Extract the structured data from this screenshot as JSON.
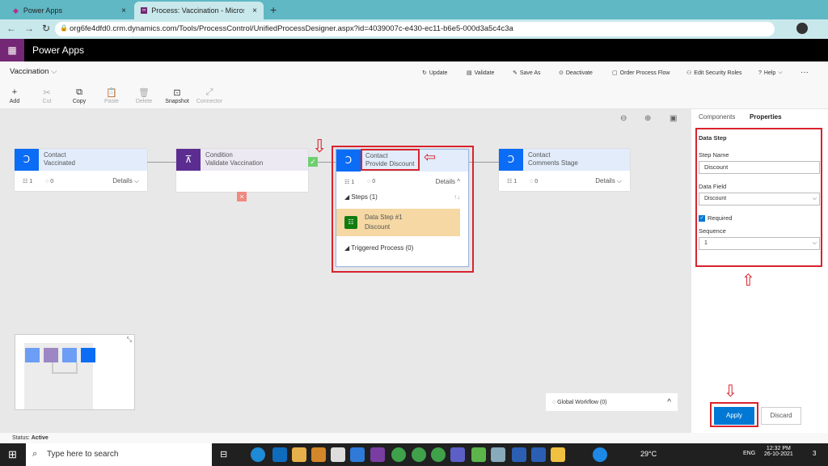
{
  "browser": {
    "tabs": [
      {
        "title": "Power Apps",
        "close": "×"
      },
      {
        "title": "Process: Vaccination - Microsoft D",
        "close": "×"
      }
    ],
    "new_tab": "+",
    "url": "org6fe4dfd0.crm.dynamics.com/Tools/ProcessControl/UnifiedProcessDesigner.aspx?id=4039007c-e430-ec11-b6e5-000d3a5c4c3a"
  },
  "app": {
    "name": "Power Apps",
    "waffle": "⋮⋮⋮"
  },
  "process": {
    "name": "Vaccination"
  },
  "toolbar": [
    {
      "label": "Add",
      "icon": "+",
      "enabled": true
    },
    {
      "label": "Cut",
      "icon": "✂",
      "enabled": false
    },
    {
      "label": "Copy",
      "icon": "⧉",
      "enabled": true
    },
    {
      "label": "Paste",
      "icon": "📋",
      "enabled": false
    },
    {
      "label": "Delete",
      "icon": "🗑",
      "enabled": false
    },
    {
      "label": "Snapshot",
      "icon": "⊡",
      "enabled": true
    },
    {
      "label": "Connector",
      "icon": "⤢",
      "enabled": false
    }
  ],
  "actions": [
    {
      "label": "Update",
      "icon": "↻"
    },
    {
      "label": "Validate",
      "icon": "▤"
    },
    {
      "label": "Save As",
      "icon": "✎"
    },
    {
      "label": "Deactivate",
      "icon": "⊙"
    },
    {
      "label": "Order Process Flow",
      "icon": "▢"
    },
    {
      "label": "Edit Security Roles",
      "icon": "⚇"
    },
    {
      "label": "Help",
      "icon": "?"
    }
  ],
  "more": "···",
  "stages": [
    {
      "entity": "Contact",
      "name": "Vaccinated",
      "steps": "1",
      "triggers": "0",
      "details": "Details"
    },
    {
      "entity": "Condition",
      "name": "Validate Vaccination"
    },
    {
      "entity": "Contact",
      "name": "Provide Discount",
      "steps": "1",
      "triggers": "0",
      "details": "Details",
      "steps_label": "Steps (1)",
      "step": {
        "title": "Data Step #1",
        "field": "Discount"
      },
      "triggered": "Triggered Process (0)"
    },
    {
      "entity": "Contact",
      "name": "Comments Stage",
      "steps": "1",
      "triggers": "0",
      "details": "Details"
    }
  ],
  "global_workflow": "Global Workflow (0)",
  "panel": {
    "tabs": [
      "Components",
      "Properties"
    ],
    "section": "Data Step",
    "step_name_label": "Step Name",
    "step_name": "Discount",
    "data_field_label": "Data Field",
    "data_field": "Discount",
    "required_label": "Required",
    "sequence_label": "Sequence",
    "sequence": "1",
    "apply": "Apply",
    "discard": "Discard"
  },
  "status": {
    "label": "Status:",
    "value": "Active"
  },
  "taskbar": {
    "search": "Type here to search",
    "weather": "29°C",
    "lang": "ENG",
    "time": "12:32 PM",
    "date": "26-10-2021",
    "notif": "3"
  },
  "colors": {
    "accent": "#0078d4",
    "stage": "#0b6cf5",
    "condition": "#5c2d91",
    "highlight": "#d9232e"
  }
}
